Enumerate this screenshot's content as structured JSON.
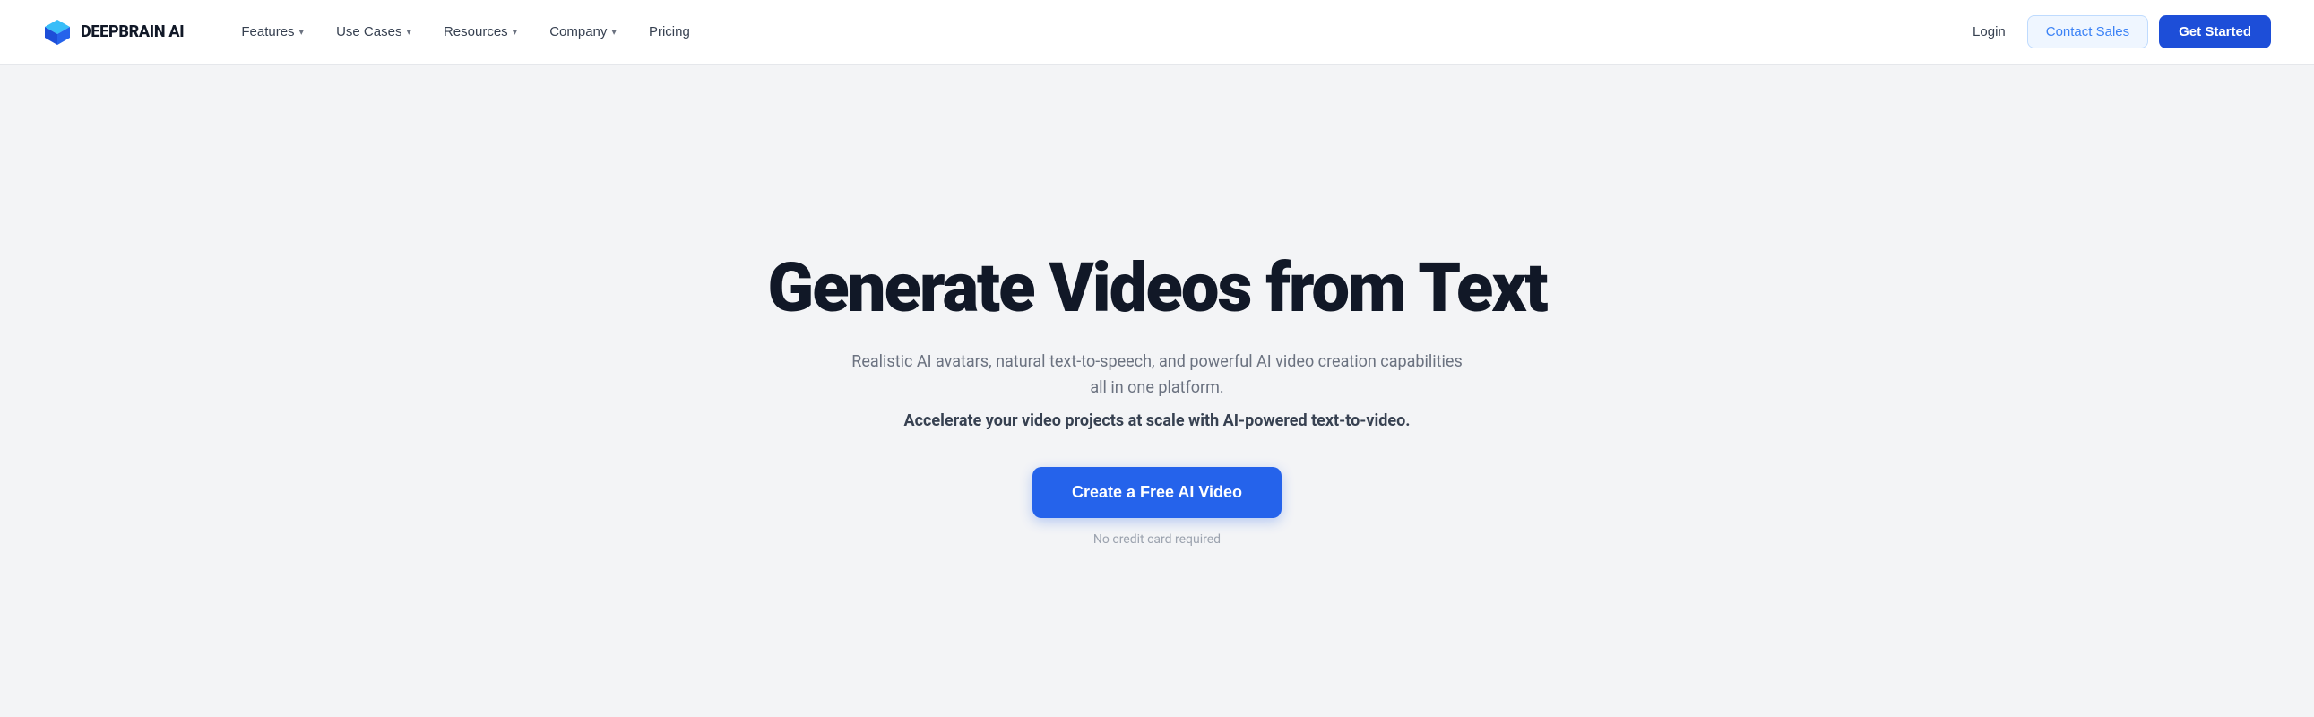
{
  "nav": {
    "logo_text": "DEEPBRAIN AI",
    "links": [
      {
        "label": "Features",
        "has_dropdown": true
      },
      {
        "label": "Use Cases",
        "has_dropdown": true
      },
      {
        "label": "Resources",
        "has_dropdown": true
      },
      {
        "label": "Company",
        "has_dropdown": true
      },
      {
        "label": "Pricing",
        "has_dropdown": false
      }
    ],
    "login_label": "Login",
    "contact_label": "Contact Sales",
    "get_started_label": "Get Started"
  },
  "hero": {
    "title": "Generate Videos from Text",
    "subtitle": "Realistic AI avatars, natural text-to-speech, and powerful AI video creation capabilities all in one platform.",
    "subtitle_bold": "Accelerate your video projects at scale with AI-powered text-to-video.",
    "cta_label": "Create a Free AI Video",
    "no_credit_label": "No credit card required"
  },
  "colors": {
    "logo_blue": "#2563eb",
    "cta_blue": "#2563eb",
    "get_started_blue": "#1d4ed8"
  }
}
